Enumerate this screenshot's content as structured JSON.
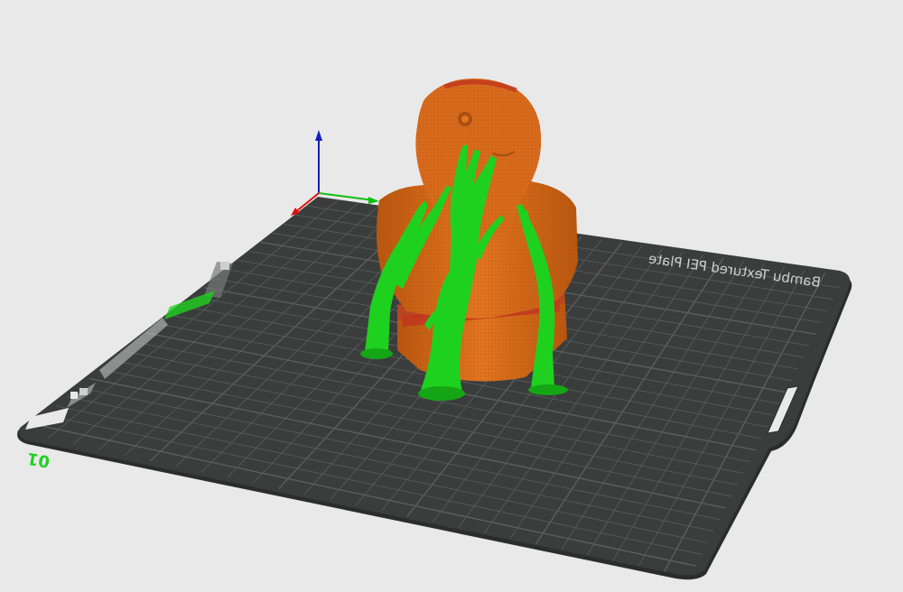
{
  "viewport": {
    "plate_label": "Bambu Textured PEI Plate",
    "plate_number": "01",
    "model_name": "bust",
    "support_name": "tree-supports"
  },
  "colors": {
    "background": "#e9e9e9",
    "plate_surface": "#3b3d3d",
    "plate_grid": "#5b5e5e",
    "plate_edge": "#2b2d2d",
    "model_orange": "#d86a1c",
    "model_orange_dark": "#a84f12",
    "model_red": "#c23620",
    "support_green": "#1fd11f",
    "support_green_dark": "#14a614",
    "axis_x": "#e01010",
    "axis_y": "#10c010",
    "axis_z": "#1020c0"
  },
  "icons": [
    "axis-gizmo-icon",
    "plate-tool-icon",
    "plate-lock-icon"
  ]
}
